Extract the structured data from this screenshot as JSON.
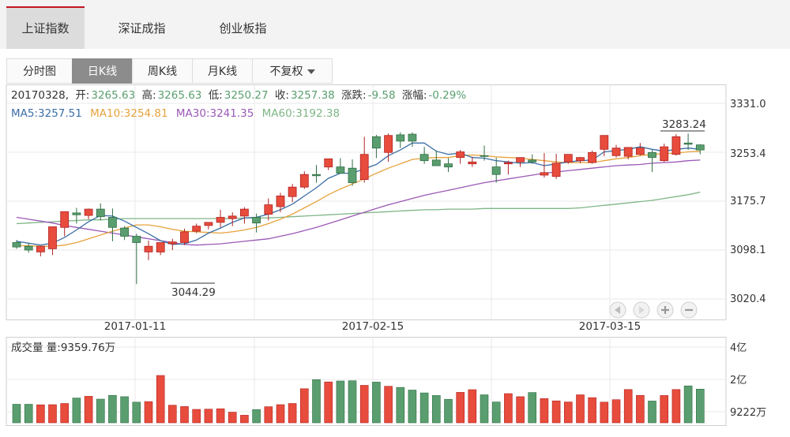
{
  "top_tabs": [
    {
      "label": "上证指数",
      "active": true
    },
    {
      "label": "深证成指",
      "active": false
    },
    {
      "label": "创业板指",
      "active": false
    }
  ],
  "sub_tabs": [
    {
      "label": "分时图",
      "active": false
    },
    {
      "label": "日K线",
      "active": true
    },
    {
      "label": "周K线",
      "active": false
    },
    {
      "label": "月K线",
      "active": false
    },
    {
      "label": "不复权",
      "active": false,
      "dropdown": true
    }
  ],
  "info": {
    "date": "20170328,",
    "open_label": "开:",
    "open": "3265.63",
    "high_label": "高:",
    "high": "3265.63",
    "low_label": "低:",
    "low": "3250.27",
    "close_label": "收:",
    "close": "3257.38",
    "change_label": "涨跌:",
    "change": "-9.58",
    "pct_label": "涨幅:",
    "pct": "-0.29%"
  },
  "ma_legend": [
    {
      "text": "MA5:3257.51",
      "color": "#3c6fa6"
    },
    {
      "text": "MA10:3254.81",
      "color": "#e6a23c"
    },
    {
      "text": "MA30:3241.35",
      "color": "#9b59b6"
    },
    {
      "text": "MA60:3192.38",
      "color": "#7fb685"
    }
  ],
  "price_axis_labels": [
    "3331.0",
    "3253.4",
    "3175.7",
    "3098.1",
    "3020.4"
  ],
  "date_axis_labels": [
    "2017-01-11",
    "2017-02-15",
    "2017-03-15"
  ],
  "annotations": {
    "max_label": "3283.24",
    "min_label": "3044.29"
  },
  "volume": {
    "title": "成交量 量:9359.76万",
    "axis_labels": [
      "4亿",
      "2亿",
      "9222万"
    ]
  },
  "colors": {
    "up": "#e74c3c",
    "down": "#5a9e6f",
    "grid": "#e8e8e8",
    "bull_border": "#b22222",
    "bear_border": "#2f6e45"
  },
  "chart_data": {
    "type": "candlestick",
    "ylim": [
      3020.4,
      3331.0
    ],
    "dates": [
      "2016-12-29",
      "2016-12-30",
      "2017-01-03",
      "2017-01-04",
      "2017-01-05",
      "2017-01-06",
      "2017-01-09",
      "2017-01-10",
      "2017-01-11",
      "2017-01-12",
      "2017-01-13",
      "2017-01-16",
      "2017-01-17",
      "2017-01-18",
      "2017-01-19",
      "2017-01-20",
      "2017-01-23",
      "2017-01-24",
      "2017-01-25",
      "2017-01-26",
      "2017-02-03",
      "2017-02-06",
      "2017-02-07",
      "2017-02-08",
      "2017-02-09",
      "2017-02-10",
      "2017-02-13",
      "2017-02-14",
      "2017-02-15",
      "2017-02-16",
      "2017-02-17",
      "2017-02-20",
      "2017-02-21",
      "2017-02-22",
      "2017-02-23",
      "2017-02-24",
      "2017-02-27",
      "2017-02-28",
      "2017-03-01",
      "2017-03-02",
      "2017-03-03",
      "2017-03-06",
      "2017-03-07",
      "2017-03-08",
      "2017-03-09",
      "2017-03-10",
      "2017-03-13",
      "2017-03-14",
      "2017-03-15",
      "2017-03-16",
      "2017-03-17",
      "2017-03-20",
      "2017-03-21",
      "2017-03-22",
      "2017-03-23",
      "2017-03-24",
      "2017-03-27",
      "2017-03-28"
    ],
    "open": [
      3110,
      3104,
      3095,
      3100,
      3134,
      3157,
      3153,
      3163,
      3150,
      3133,
      3120,
      3095,
      3095,
      3108,
      3110,
      3128,
      3137,
      3142,
      3148,
      3152,
      3150,
      3155,
      3167,
      3183,
      3198,
      3218,
      3230,
      3230,
      3228,
      3210,
      3278,
      3253,
      3281,
      3282,
      3250,
      3241,
      3235,
      3245,
      3235,
      3248,
      3230,
      3235,
      3238,
      3241,
      3217,
      3215,
      3238,
      3240,
      3237,
      3258,
      3248,
      3247,
      3250,
      3253,
      3240,
      3250,
      3268,
      3265
    ],
    "high": [
      3114,
      3109,
      3098,
      3112,
      3158,
      3165,
      3164,
      3172,
      3164,
      3136,
      3124,
      3113,
      3103,
      3116,
      3132,
      3140,
      3142,
      3162,
      3158,
      3166,
      3156,
      3180,
      3189,
      3203,
      3223,
      3233,
      3238,
      3244,
      3242,
      3278,
      3281,
      3283,
      3285,
      3285,
      3262,
      3256,
      3244,
      3257,
      3246,
      3264,
      3245,
      3240,
      3243,
      3250,
      3252,
      3251,
      3248,
      3246,
      3256,
      3268,
      3265,
      3258,
      3268,
      3257,
      3267,
      3282,
      3283,
      3266
    ],
    "low": [
      3100,
      3094,
      3088,
      3090,
      3120,
      3140,
      3147,
      3145,
      3112,
      3114,
      3044,
      3082,
      3090,
      3098,
      3106,
      3125,
      3131,
      3134,
      3136,
      3140,
      3126,
      3145,
      3158,
      3174,
      3195,
      3205,
      3225,
      3220,
      3200,
      3205,
      3244,
      3238,
      3260,
      3262,
      3235,
      3233,
      3222,
      3235,
      3230,
      3240,
      3205,
      3218,
      3230,
      3235,
      3213,
      3211,
      3235,
      3236,
      3235,
      3247,
      3245,
      3242,
      3248,
      3222,
      3238,
      3248,
      3257,
      3250
    ],
    "close": [
      3103,
      3098,
      3104,
      3135,
      3159,
      3154,
      3163,
      3151,
      3134,
      3120,
      3110,
      3104,
      3110,
      3111,
      3127,
      3136,
      3142,
      3150,
      3152,
      3163,
      3141,
      3170,
      3184,
      3198,
      3218,
      3216,
      3243,
      3220,
      3205,
      3250,
      3260,
      3280,
      3271,
      3271,
      3240,
      3232,
      3230,
      3254,
      3238,
      3247,
      3218,
      3237,
      3245,
      3238,
      3221,
      3236,
      3250,
      3245,
      3253,
      3280,
      3260,
      3261,
      3260,
      3245,
      3262,
      3278,
      3266,
      3257
    ],
    "volume": [
      0.98,
      0.98,
      0.95,
      0.96,
      1.02,
      1.31,
      1.4,
      1.25,
      1.45,
      1.38,
      1.09,
      1.12,
      2.5,
      0.93,
      0.86,
      0.71,
      0.72,
      0.74,
      0.56,
      0.4,
      0.7,
      0.85,
      0.96,
      1.02,
      1.8,
      2.28,
      2.16,
      2.21,
      2.22,
      1.98,
      2.15,
      1.93,
      1.87,
      1.73,
      1.58,
      1.44,
      1.24,
      1.61,
      1.75,
      1.48,
      1.1,
      1.54,
      1.38,
      1.6,
      1.28,
      1.16,
      1.1,
      1.48,
      1.33,
      1.09,
      1.22,
      1.76,
      1.45,
      1.15,
      1.44,
      1.76,
      1.95,
      1.78
    ],
    "ma5": [
      3112,
      3109,
      3106,
      3109,
      3118,
      3130,
      3143,
      3153,
      3152,
      3144,
      3134,
      3124,
      3113,
      3107,
      3108,
      3114,
      3125,
      3133,
      3142,
      3149,
      3150,
      3155,
      3162,
      3171,
      3184,
      3197,
      3212,
      3220,
      3220,
      3227,
      3234,
      3248,
      3257,
      3268,
      3268,
      3255,
      3250,
      3252,
      3245,
      3244,
      3240,
      3238,
      3236,
      3237,
      3232,
      3235,
      3238,
      3240,
      3241,
      3254,
      3256,
      3258,
      3262,
      3258,
      3255,
      3258,
      3260,
      3258
    ],
    "ma10": [
      3105,
      3105,
      3104,
      3104,
      3106,
      3110,
      3116,
      3122,
      3128,
      3133,
      3138,
      3138,
      3135,
      3131,
      3128,
      3127,
      3126,
      3125,
      3127,
      3130,
      3134,
      3140,
      3147,
      3155,
      3165,
      3175,
      3186,
      3195,
      3203,
      3211,
      3220,
      3228,
      3235,
      3242,
      3244,
      3245,
      3245,
      3248,
      3249,
      3248,
      3246,
      3245,
      3244,
      3242,
      3240,
      3238,
      3237,
      3237,
      3237,
      3240,
      3243,
      3245,
      3248,
      3250,
      3251,
      3252,
      3254,
      3255
    ],
    "ma30": [
      3150,
      3147,
      3144,
      3141,
      3137,
      3134,
      3131,
      3128,
      3125,
      3122,
      3119,
      3116,
      3113,
      3110,
      3107,
      3106,
      3107,
      3108,
      3110,
      3112,
      3114,
      3116,
      3120,
      3124,
      3129,
      3134,
      3140,
      3146,
      3152,
      3158,
      3164,
      3170,
      3175,
      3180,
      3185,
      3189,
      3193,
      3197,
      3201,
      3205,
      3208,
      3211,
      3214,
      3217,
      3220,
      3222,
      3224,
      3226,
      3228,
      3230,
      3232,
      3233,
      3234,
      3236,
      3237,
      3238,
      3240,
      3241
    ],
    "ma60": [
      3140,
      3141,
      3142,
      3143,
      3144,
      3145,
      3146,
      3146,
      3147,
      3148,
      3148,
      3148,
      3148,
      3148,
      3148,
      3148,
      3148,
      3148,
      3148,
      3149,
      3149,
      3149,
      3150,
      3151,
      3152,
      3153,
      3154,
      3155,
      3156,
      3157,
      3158,
      3159,
      3160,
      3161,
      3162,
      3162,
      3163,
      3163,
      3163,
      3164,
      3164,
      3164,
      3164,
      3164,
      3164,
      3164,
      3164,
      3165,
      3167,
      3169,
      3171,
      3173,
      3175,
      3177,
      3180,
      3183,
      3186,
      3190
    ]
  }
}
